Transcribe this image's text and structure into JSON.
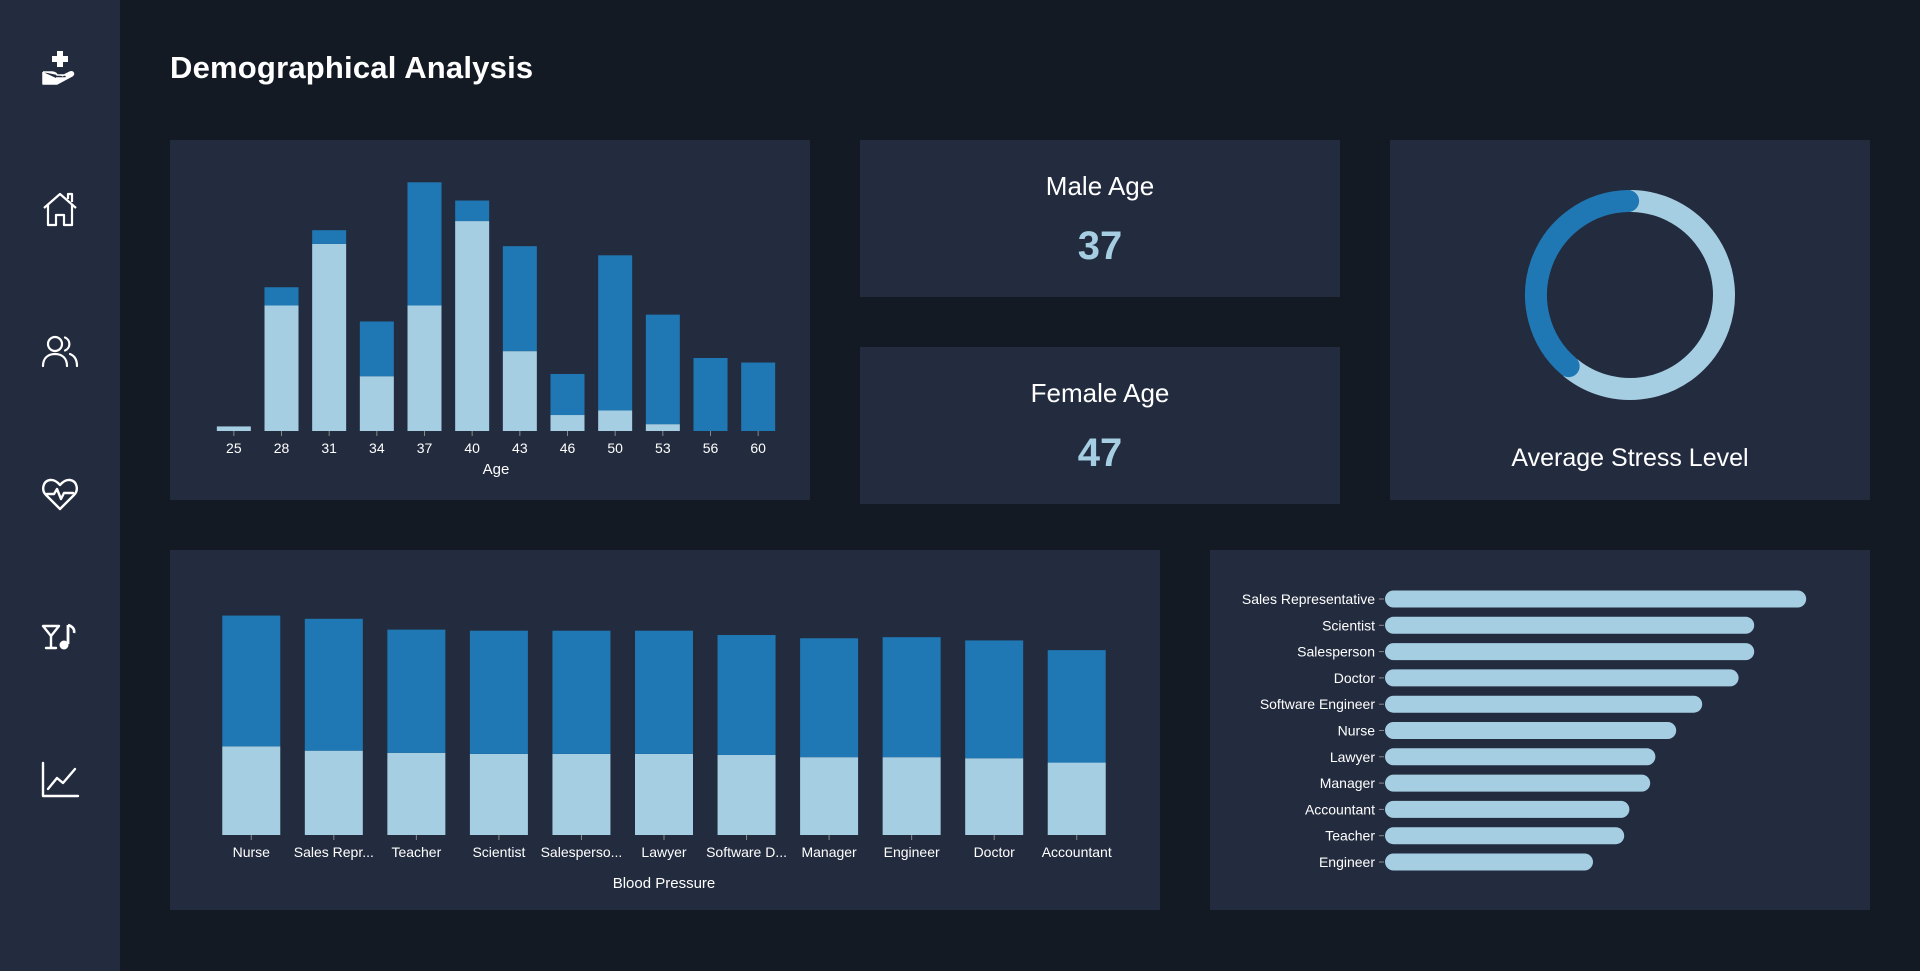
{
  "page": {
    "title": "Demographical Analysis"
  },
  "sidebar": {
    "items": [
      {
        "icon": "hand-medical-icon",
        "label": "Logo"
      },
      {
        "icon": "home-icon",
        "label": "Home"
      },
      {
        "icon": "users-icon",
        "label": "Demographics"
      },
      {
        "icon": "heart-pulse-icon",
        "label": "Health"
      },
      {
        "icon": "lifestyle-icon",
        "label": "Lifestyle"
      },
      {
        "icon": "chart-line-icon",
        "label": "Trends"
      }
    ]
  },
  "cards": {
    "male_age": {
      "title": "Male Age",
      "value": "37"
    },
    "female_age": {
      "title": "Female Age",
      "value": "47"
    },
    "stress": {
      "title": "Average Stress Level"
    }
  },
  "colors": {
    "dark_blue": "#1f78b4",
    "light_blue": "#a6cee3",
    "panel": "#232b3e",
    "background": "#131a24"
  },
  "chart_data": [
    {
      "id": "age-chart",
      "type": "bar",
      "stacked": true,
      "xlabel": "Age",
      "categories": [
        "25",
        "28",
        "31",
        "34",
        "37",
        "40",
        "43",
        "46",
        "50",
        "53",
        "56",
        "60"
      ],
      "series": [
        {
          "color": "#a6cee3",
          "values": [
            2,
            55,
            82,
            24,
            55,
            92,
            35,
            7,
            9,
            3,
            0,
            0
          ]
        },
        {
          "color": "#1f78b4",
          "values": [
            0,
            8,
            6,
            24,
            54,
            9,
            46,
            18,
            68,
            48,
            32,
            30
          ]
        }
      ],
      "ylim": [
        0,
        110
      ]
    },
    {
      "id": "stress-donut",
      "type": "pie",
      "donut": true,
      "series": [
        {
          "color": "#a6cee3",
          "value": 61
        },
        {
          "color": "#1f78b4",
          "value": 39
        }
      ]
    },
    {
      "id": "bp-chart",
      "type": "bar",
      "stacked": true,
      "xlabel": "Blood Pressure",
      "categories": [
        "Nurse",
        "Sales Repr...",
        "Teacher",
        "Scientist",
        "Salesperso...",
        "Lawyer",
        "Software D...",
        "Manager",
        "Engineer",
        "Doctor",
        "Accountant"
      ],
      "series": [
        {
          "color": "#a6cee3",
          "values": [
            82,
            78,
            76,
            75,
            75,
            75,
            74,
            72,
            72,
            71,
            67
          ]
        },
        {
          "color": "#1f78b4",
          "values": [
            121,
            122,
            114,
            114,
            114,
            114,
            111,
            110,
            111,
            109,
            104
          ]
        }
      ],
      "ylim": [
        0,
        210
      ]
    },
    {
      "id": "occupation-chart",
      "type": "bar",
      "orientation": "horizontal",
      "categories": [
        "Sales Representative",
        "Scientist",
        "Salesperson",
        "Doctor",
        "Software Engineer",
        "Nurse",
        "Lawyer",
        "Manager",
        "Accountant",
        "Teacher",
        "Engineer"
      ],
      "values": [
        81,
        71,
        71,
        68,
        61,
        56,
        52,
        51,
        47,
        46,
        40
      ],
      "color": "#a6cee3",
      "xlim": [
        0,
        85
      ]
    }
  ]
}
